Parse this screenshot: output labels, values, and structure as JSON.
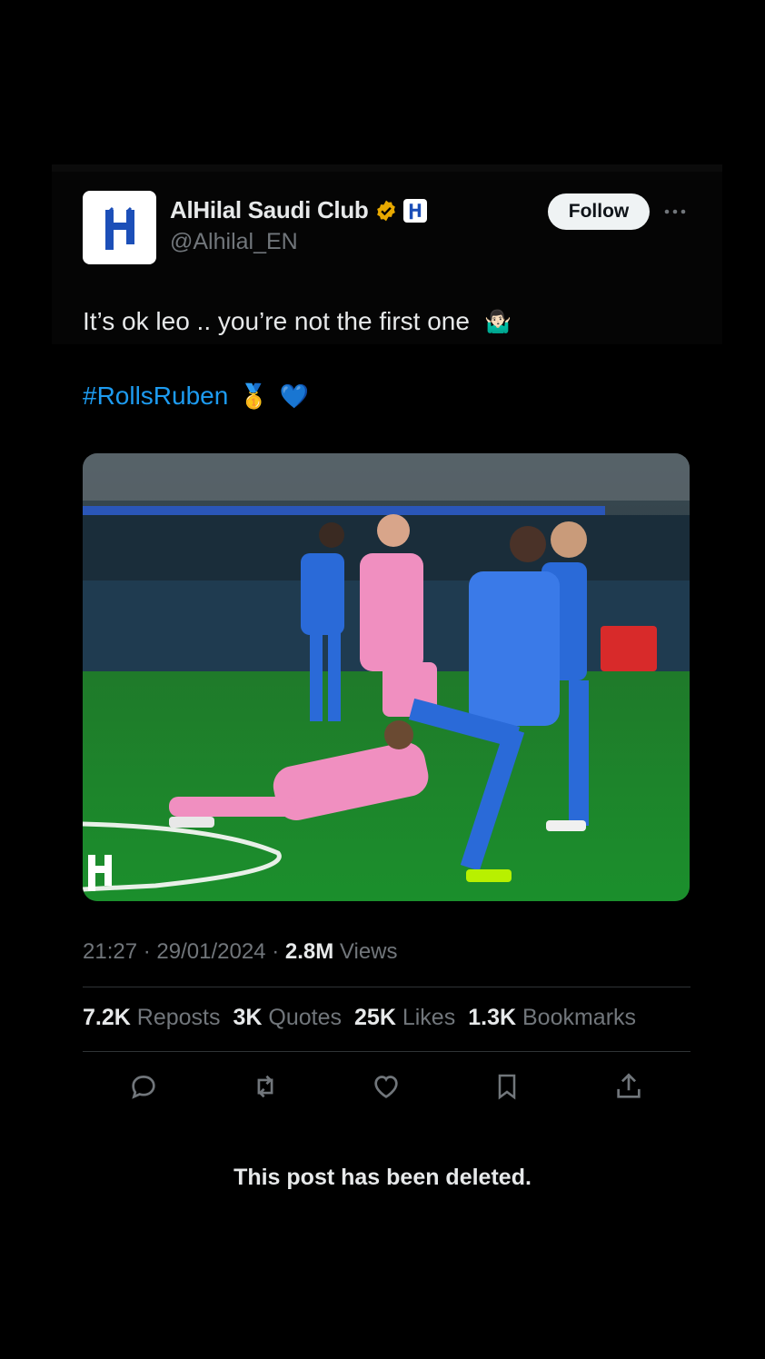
{
  "post": {
    "author_name": "AlHilal Saudi Club",
    "handle": "@Alhilal_EN",
    "follow_label": "Follow",
    "text_line": "It’s ok leo .. you’re not the first one",
    "hashtag": "#RollsRuben",
    "emoji_shrug": "🤷🏻‍♂️",
    "emoji_medal": "🥇",
    "emoji_heart": "💙",
    "image_badge": " ",
    "time": "21:27",
    "date": "29/01/2024",
    "views_count": "2.8M",
    "views_label": "Views",
    "stats": {
      "reposts_count": "7.2K",
      "reposts_label": "Reposts",
      "quotes_count": "3K",
      "quotes_label": "Quotes",
      "likes_count": "25K",
      "likes_label": "Likes",
      "bookmarks_count": "1.3K",
      "bookmarks_label": "Bookmarks"
    }
  },
  "status_message": "This post has been deleted.",
  "colors": {
    "background": "#000000",
    "link": "#1d9bf0",
    "muted": "#71767b",
    "verified": "#e8a900",
    "brand": "#1c4fb8"
  }
}
